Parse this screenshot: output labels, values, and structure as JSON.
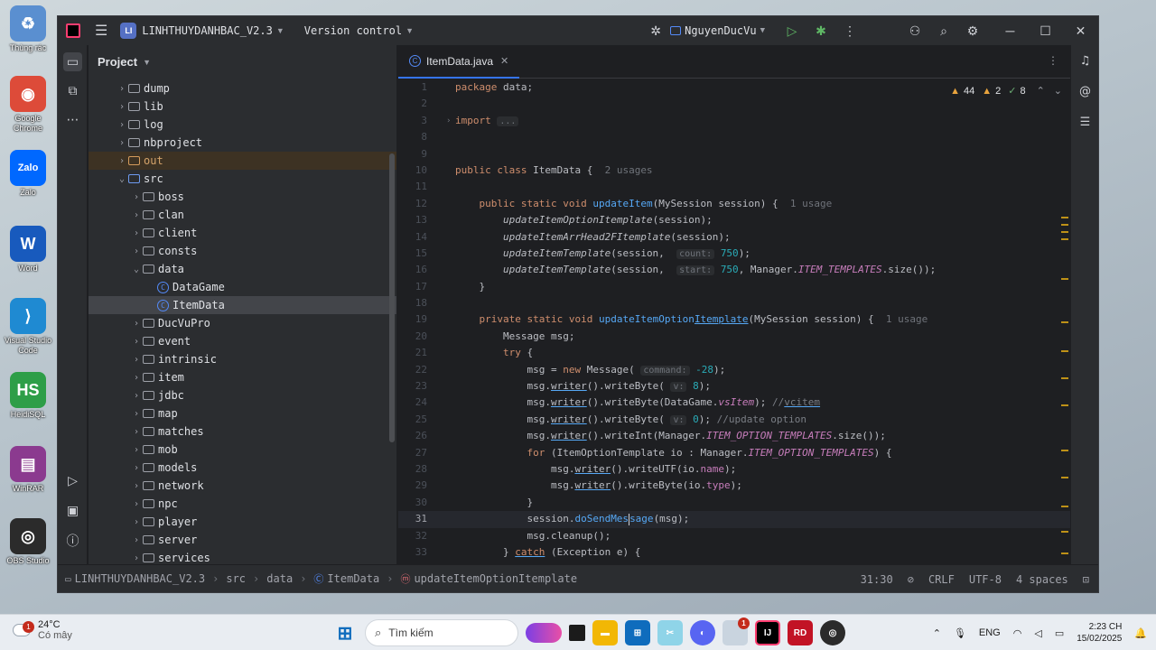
{
  "desktop": {
    "icons": [
      {
        "label": "Thùng rác",
        "color": "#5a8fd0",
        "glyph": "♻"
      },
      {
        "label": "Google Chrome",
        "color": "#dd4b39",
        "glyph": "◉"
      },
      {
        "label": "Zalo",
        "color": "#0068ff",
        "glyph": "Zalo"
      },
      {
        "label": "Word",
        "color": "#185abd",
        "glyph": "W"
      },
      {
        "label": "Visual Studio Code",
        "color": "#1f8ad2",
        "glyph": "⟩"
      },
      {
        "label": "HeidiSQL",
        "color": "#2e9e48",
        "glyph": "HS"
      },
      {
        "label": "WinRAR",
        "color": "#8b3a8f",
        "glyph": "▤"
      },
      {
        "label": "OBS Studio",
        "color": "#2b2b2b",
        "glyph": "◎"
      }
    ]
  },
  "titlebar": {
    "project_badge": "LI",
    "project_name": "LINHTHUYDANHBAC_V2.3",
    "vcs": "Version control",
    "run_config": "NguyenDucVu"
  },
  "project_panel": {
    "title": "Project",
    "tree": [
      {
        "label": "dump",
        "indent": 1,
        "arrow": "›",
        "type": "folder"
      },
      {
        "label": "lib",
        "indent": 1,
        "arrow": "›",
        "type": "folder"
      },
      {
        "label": "log",
        "indent": 1,
        "arrow": "›",
        "type": "folder"
      },
      {
        "label": "nbproject",
        "indent": 1,
        "arrow": "›",
        "type": "folder"
      },
      {
        "label": "out",
        "indent": 1,
        "arrow": "›",
        "type": "folder-orange",
        "state": "highlight"
      },
      {
        "label": "src",
        "indent": 1,
        "arrow": "⌄",
        "type": "folder-blue"
      },
      {
        "label": "boss",
        "indent": 2,
        "arrow": "›",
        "type": "package"
      },
      {
        "label": "clan",
        "indent": 2,
        "arrow": "›",
        "type": "package"
      },
      {
        "label": "client",
        "indent": 2,
        "arrow": "›",
        "type": "package"
      },
      {
        "label": "consts",
        "indent": 2,
        "arrow": "›",
        "type": "package"
      },
      {
        "label": "data",
        "indent": 2,
        "arrow": "⌄",
        "type": "package"
      },
      {
        "label": "DataGame",
        "indent": 3,
        "arrow": "",
        "type": "class"
      },
      {
        "label": "ItemData",
        "indent": 3,
        "arrow": "",
        "type": "class",
        "state": "selected"
      },
      {
        "label": "DucVuPro",
        "indent": 2,
        "arrow": "›",
        "type": "package"
      },
      {
        "label": "event",
        "indent": 2,
        "arrow": "›",
        "type": "package"
      },
      {
        "label": "intrinsic",
        "indent": 2,
        "arrow": "›",
        "type": "package"
      },
      {
        "label": "item",
        "indent": 2,
        "arrow": "›",
        "type": "package"
      },
      {
        "label": "jdbc",
        "indent": 2,
        "arrow": "›",
        "type": "package"
      },
      {
        "label": "map",
        "indent": 2,
        "arrow": "›",
        "type": "package"
      },
      {
        "label": "matches",
        "indent": 2,
        "arrow": "›",
        "type": "package"
      },
      {
        "label": "mob",
        "indent": 2,
        "arrow": "›",
        "type": "package"
      },
      {
        "label": "models",
        "indent": 2,
        "arrow": "›",
        "type": "package"
      },
      {
        "label": "network",
        "indent": 2,
        "arrow": "›",
        "type": "package"
      },
      {
        "label": "npc",
        "indent": 2,
        "arrow": "›",
        "type": "package"
      },
      {
        "label": "player",
        "indent": 2,
        "arrow": "›",
        "type": "package"
      },
      {
        "label": "server",
        "indent": 2,
        "arrow": "›",
        "type": "package"
      },
      {
        "label": "services",
        "indent": 2,
        "arrow": "›",
        "type": "package"
      }
    ]
  },
  "editor": {
    "tab_label": "ItemData.java",
    "inspections": {
      "warnings": "44",
      "weak_warnings": "2",
      "ok": "8"
    },
    "current_line": "31",
    "lines": [
      {
        "n": "1",
        "html": "<span class=\"kw\">package</span> data;"
      },
      {
        "n": "2",
        "html": ""
      },
      {
        "n": "3",
        "html": "<span class=\"kw\">import</span> <span class=\"hint\">...</span>",
        "fold": "›"
      },
      {
        "n": "8",
        "html": ""
      },
      {
        "n": "9",
        "html": ""
      },
      {
        "n": "10",
        "html": "<span class=\"kw\">public class</span> ItemData {  <span class=\"usage\">2 usages</span>"
      },
      {
        "n": "11",
        "html": ""
      },
      {
        "n": "12",
        "html": "    <span class=\"kw\">public static void</span> <span class=\"fn\">updateItem</span>(MySession session) {  <span class=\"usage\">1 usage</span>"
      },
      {
        "n": "13",
        "html": "        <span class=\"ital\">updateItemOptionItemplate</span>(session);"
      },
      {
        "n": "14",
        "html": "        <span class=\"ital\">updateItemArrHead2FItemplate</span>(session);"
      },
      {
        "n": "15",
        "html": "        <span class=\"ital\">updateItemTemplate</span>(session,  <span class=\"hint\">count:</span> <span class=\"num\">750</span>);"
      },
      {
        "n": "16",
        "html": "        <span class=\"ital\">updateItemTemplate</span>(session,  <span class=\"hint\">start:</span> <span class=\"num\">750</span>, Manager.<span class=\"fld\">ITEM_TEMPLATES</span>.size());"
      },
      {
        "n": "17",
        "html": "    }"
      },
      {
        "n": "18",
        "html": ""
      },
      {
        "n": "19",
        "html": "    <span class=\"kw\">private static void</span> <span class=\"fn\">updateItemOption<span class=\"ul\">Itemplate</span></span>(MySession session) {  <span class=\"usage\">1 usage</span>"
      },
      {
        "n": "20",
        "html": "        Message msg;"
      },
      {
        "n": "21",
        "html": "        <span class=\"kw\">try</span> {"
      },
      {
        "n": "22",
        "html": "            msg = <span class=\"kw\">new</span> Message( <span class=\"hint\">command:</span> <span class=\"num\">-28</span>);"
      },
      {
        "n": "23",
        "html": "            msg.<span class=\"ul\">writer</span>().writeByte( <span class=\"hint\">v:</span> <span class=\"num\">8</span>);"
      },
      {
        "n": "24",
        "html": "            msg.<span class=\"ul\">writer</span>().writeByte(DataGame.<span class=\"fld\">vsItem</span>); <span class=\"cmt\">//<span class=\"ul\">vcitem</span></span>"
      },
      {
        "n": "25",
        "html": "            msg.<span class=\"ul\">writer</span>().writeByte( <span class=\"hint\">v:</span> <span class=\"num\">0</span>); <span class=\"cmt\">//update option</span>"
      },
      {
        "n": "26",
        "html": "            msg.<span class=\"ul\">writer</span>().writeInt(Manager.<span class=\"fld\">ITEM_OPTION_TEMPLATES</span>.size());"
      },
      {
        "n": "27",
        "html": "            <span class=\"kw\">for</span> (ItemOptionTemplate io : Manager.<span class=\"fld\">ITEM_OPTION_TEMPLATES</span>) {"
      },
      {
        "n": "28",
        "html": "                msg.<span class=\"ul\">writer</span>().writeUTF(io.<span class=\"fld2\">name</span>);"
      },
      {
        "n": "29",
        "html": "                msg.<span class=\"ul\">writer</span>().writeByte(io.<span class=\"fld2\">type</span>);"
      },
      {
        "n": "30",
        "html": "            }"
      },
      {
        "n": "31",
        "html": "            session.<span class=\"fn\">doSendMes<span class=\"cursor\"></span>sage</span>(msg);"
      },
      {
        "n": "32",
        "html": "            msg.cleanup();"
      },
      {
        "n": "33",
        "html": "        } <span class=\"kw\"><span class=\"ul\">catch</span></span> (Exception e) {"
      }
    ]
  },
  "statusbar": {
    "crumbs": [
      "LINHTHUYDANHBAC_V2.3",
      "src",
      "data",
      "ItemData",
      "updateItemOptionItemplate"
    ],
    "position": "31:30",
    "line_sep": "CRLF",
    "encoding": "UTF-8",
    "indent": "4 spaces"
  },
  "taskbar": {
    "weather_temp": "24°C",
    "weather_desc": "Có mây",
    "weather_badge": "1",
    "search_placeholder": "Tìm kiếm",
    "chrome_badge": "1",
    "lang": "ENG",
    "time": "2:23 CH",
    "date": "15/02/2025"
  }
}
